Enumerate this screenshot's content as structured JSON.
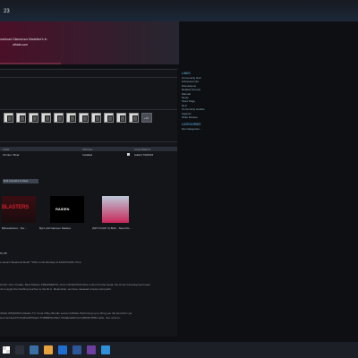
{
  "header": {
    "title": "23"
  },
  "banner": {
    "line1": "ownload Glamorous Madeline's in",
    "line2": "othide.com"
  },
  "achievements": {
    "more_label": "+15"
  },
  "dlc": {
    "headers": [
      "ITEM",
      "INSTALL",
      "ACQUIRED ▾"
    ],
    "rows": [
      {
        "name": "Omnia I: Boar",
        "state": "Installed",
        "acquired": "Added 7/9/2015"
      }
    ],
    "manage_button": "Find more DLC in Store"
  },
  "workshop": {
    "items": [
      {
        "thumb_text": "BLASTERS",
        "caption": "B|Freakshoot - Tax..."
      },
      {
        "thumb_text": "RAIDEN",
        "caption": "Byrs x20 Glamour Raiders"
      },
      {
        "thumb_text": "",
        "caption": "[SPY.COOP V] BNC - Steel Mo..."
      }
    ]
  },
  "news": {
    "heading": "% Off",
    "lines": [
      "e week's Weekend Deal!* *Offer ends Monday at 10AM Pacific Time.",
      "",
      "ALSO: DLC Omake, Best Raiders PRESIDENTS, Frost OP EDITION After a short Kordie break, the Arma 3 development team",
      "nd to apply the finishing touches to the DLC. Meanwhile, we have released a beta Lock patch.",
      "",
      "4NGH ZIPHZONG Raiden TV: Arma 3 Buy Bundle Lesser (Offside Performing up to bring you the best DLC yet",
      "wed 4e7aee27b16n8dc097f0ae2 ThtBB8f2bcr8le2 T02a8e0a8d 2ec1d95d07/PBF Hello, nice work to..."
    ]
  },
  "sidebar": {
    "links_header": "LINKS",
    "links": [
      "Community Hub",
      "Achievements",
      "Discussions",
      "Related Groups",
      "Manual",
      "News",
      "Store Page",
      "DLC",
      "Community Guides",
      "Support",
      "Write Review"
    ],
    "categories_header": "CATEGORIES",
    "categories": [
      "Set Categories..."
    ]
  },
  "taskbar": {
    "label": ""
  }
}
